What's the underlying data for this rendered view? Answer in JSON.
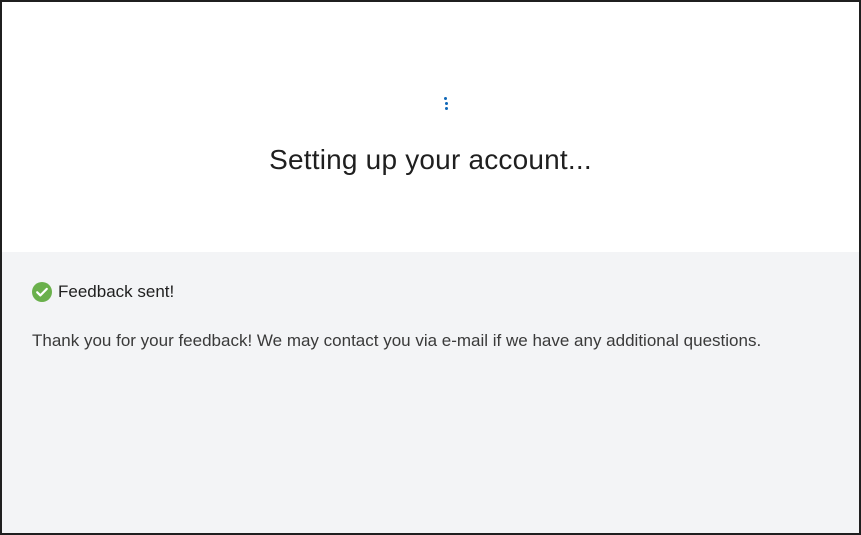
{
  "setup": {
    "title": "Setting up your account..."
  },
  "feedback": {
    "status": "Feedback sent!",
    "message": "Thank you for your feedback! We may contact you via e-mail if we have any additional questions."
  },
  "icons": {
    "spinner": "loading-spinner-icon",
    "status": "check-circle-icon"
  },
  "colors": {
    "accent": "#1068b8",
    "success": "#6ab04c",
    "bottom_background": "#f3f4f6"
  }
}
